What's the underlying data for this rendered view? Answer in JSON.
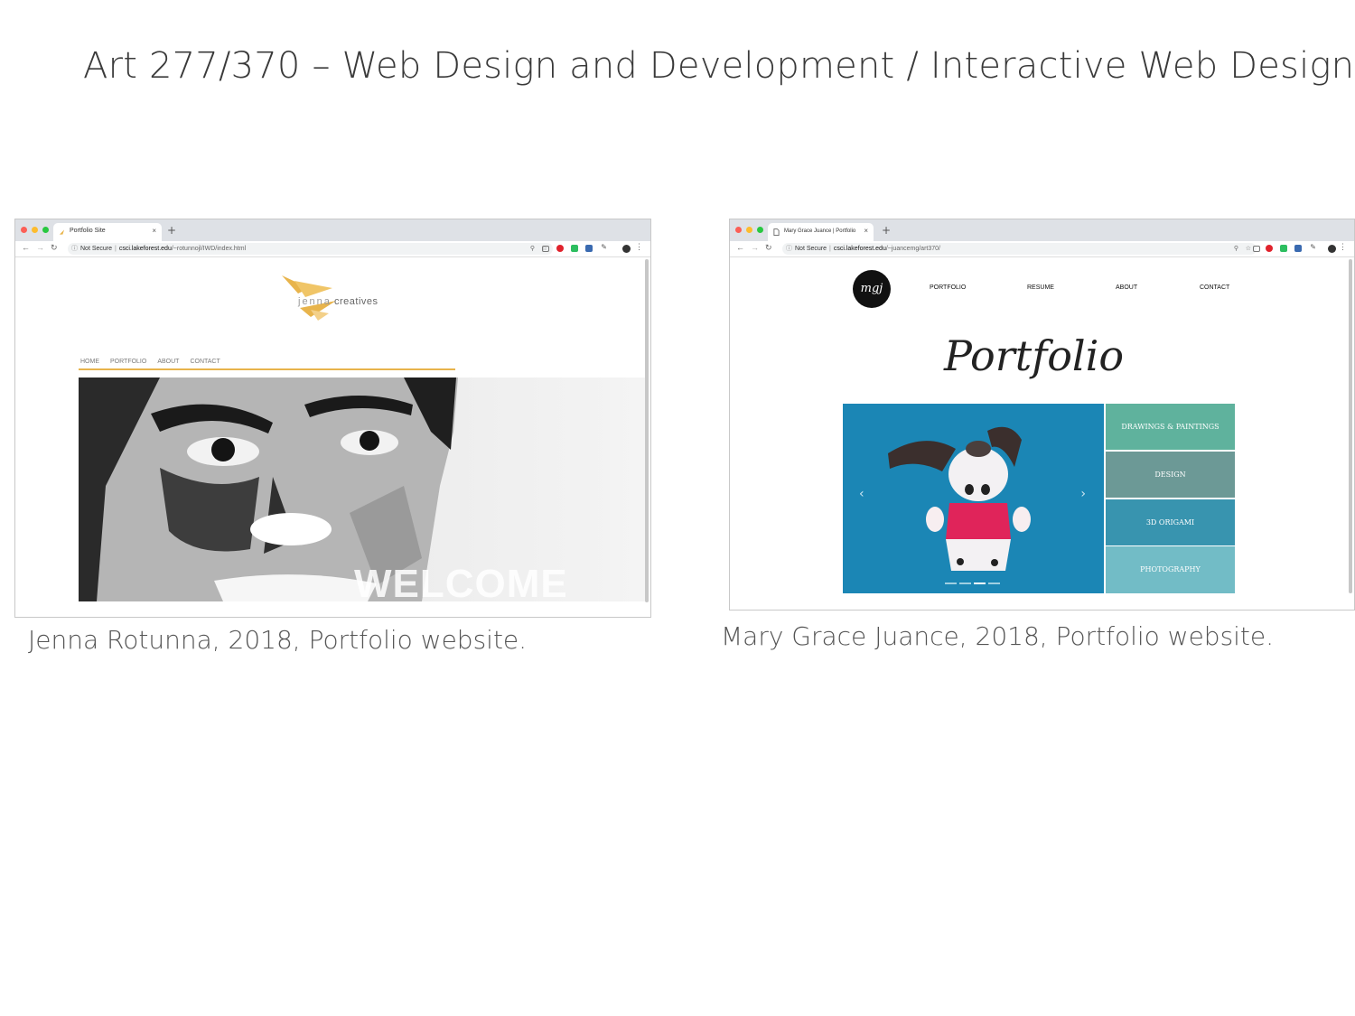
{
  "slide": {
    "title": "Art 277/370 – Web Design and Development / Interactive Web Design"
  },
  "captions": {
    "left": "Jenna Rotunna, 2018, Portfolio website.",
    "right": "Mary Grace Juance, 2018, Portfolio website."
  },
  "browser_left": {
    "tab_title": "Portfolio Site",
    "security": "Not Secure",
    "url_host": "csci.lakeforest.edu",
    "url_path": "/~rotunnojl/IWD/index.html",
    "site": {
      "logo_text_light": "jenna",
      "logo_text_bold": "creatives",
      "nav": [
        "HOME",
        "PORTFOLIO",
        "ABOUT",
        "CONTACT"
      ],
      "hero_text": "WELCOME",
      "accent_color": "#e8b44c"
    }
  },
  "browser_right": {
    "tab_title": "Mary Grace Juance | Portfolio",
    "security": "Not Secure",
    "url_host": "csci.lakeforest.edu",
    "url_path": "/~juancemg/art370/",
    "site": {
      "logo_text": "mgj",
      "nav": [
        "PORTFOLIO",
        "RESUME",
        "ABOUT",
        "CONTACT"
      ],
      "heading": "Portfolio",
      "carousel": {
        "prev": "‹",
        "next": "›",
        "slides": 4,
        "active_slide": 3
      },
      "tiles": [
        {
          "label": "DRAWINGS & PAINTINGS",
          "color": "#5fb29d"
        },
        {
          "label": "DESIGN",
          "color": "#6c9996"
        },
        {
          "label": "3D ORIGAMI",
          "color": "#3894af"
        },
        {
          "label": "PHOTOGRAPHY",
          "color": "#72bcc6"
        }
      ]
    }
  },
  "icons": {
    "window_controls": [
      "close-dot",
      "minimize-dot",
      "maximize-dot"
    ],
    "nav": [
      "back-icon",
      "forward-icon",
      "reload-icon"
    ],
    "omnibox": [
      "info-icon",
      "zoom-icon",
      "star-icon"
    ],
    "extensions": [
      "cast-icon",
      "opera-icon",
      "evernote-icon",
      "bookmark-icon",
      "eyedropper-icon",
      "profile-icon",
      "menu-icon"
    ]
  }
}
